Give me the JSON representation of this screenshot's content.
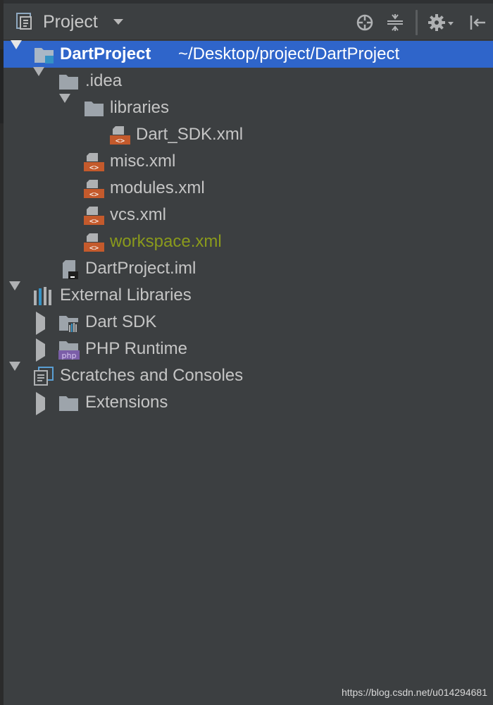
{
  "header": {
    "view_title": "Project",
    "icons": [
      "project-view-icon",
      "locate-icon",
      "collapse-all-icon",
      "gear-icon",
      "hide-panel-icon"
    ]
  },
  "tree": {
    "root": {
      "name": "DartProject",
      "path": "~/Desktop/project/DartProject"
    },
    "idea": ".idea",
    "libraries": "libraries",
    "dart_sdk_xml": "Dart_SDK.xml",
    "misc_xml": "misc.xml",
    "modules_xml": "modules.xml",
    "vcs_xml": "vcs.xml",
    "workspace_xml": "workspace.xml",
    "iml": "DartProject.iml",
    "external_libraries": "External Libraries",
    "dart_sdk": "Dart SDK",
    "php_runtime": "PHP Runtime",
    "php_badge": "php",
    "scratches": "Scratches and Consoles",
    "extensions": "Extensions"
  },
  "colors": {
    "background": "#3c3f41",
    "selection": "#2f65ca",
    "modified_file": "#8a9a1c",
    "xml_icon": "#c45a2c",
    "folder": "#9da4ab"
  },
  "watermark": "https://blog.csdn.net/u014294681"
}
